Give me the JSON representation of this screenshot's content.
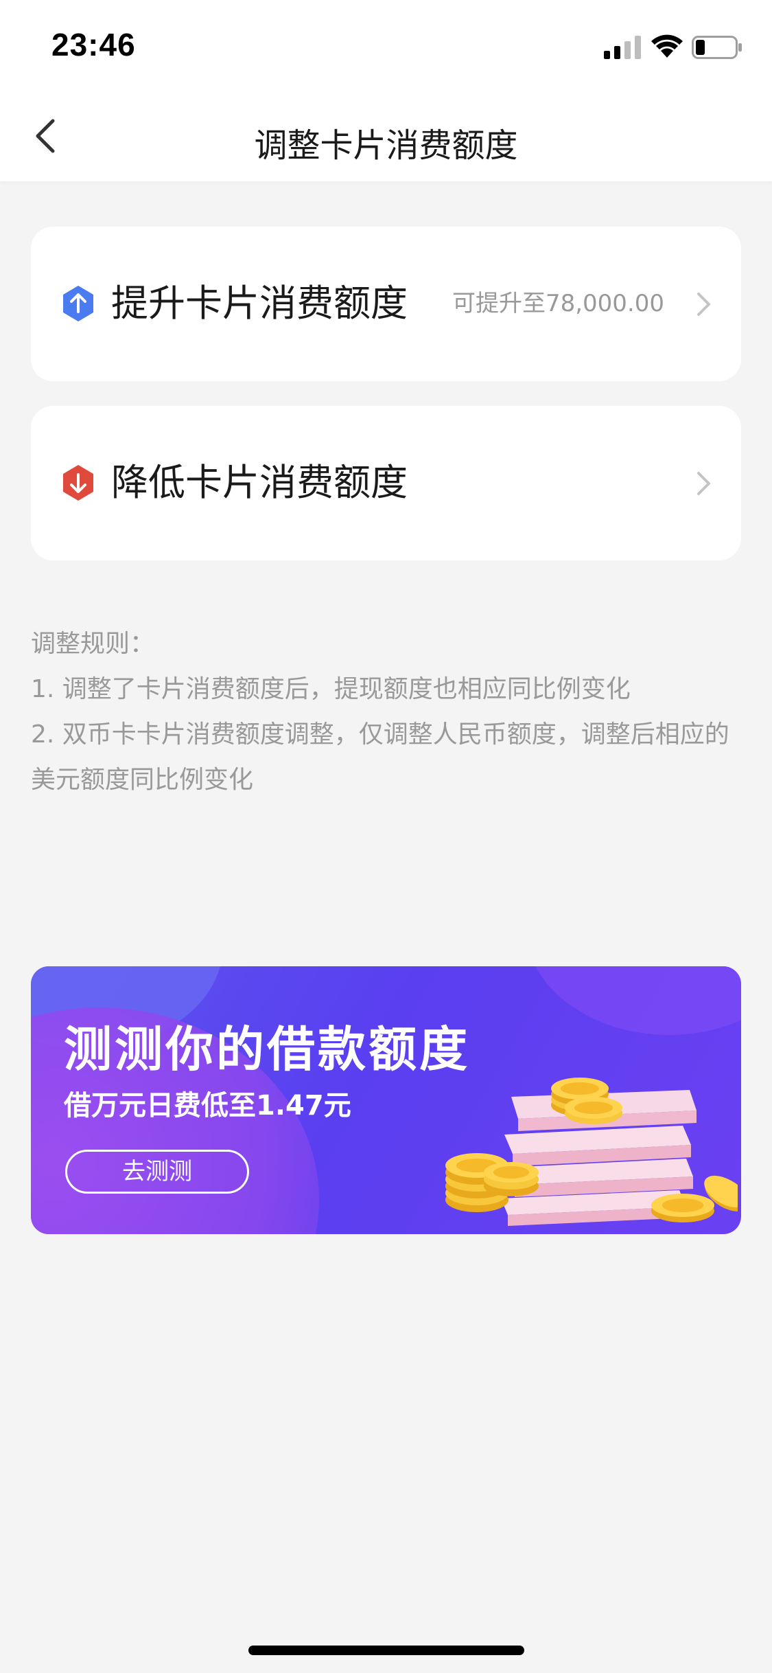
{
  "status_bar": {
    "time": "23:46"
  },
  "nav": {
    "title": "调整卡片消费额度"
  },
  "options": [
    {
      "label": "提升卡片消费额度",
      "hint": "可提升至78,000.00",
      "icon": "arrow-up-icon",
      "icon_color": "#4a7bf0"
    },
    {
      "label": "降低卡片消费额度",
      "hint": "",
      "icon": "arrow-down-icon",
      "icon_color": "#e04a3c"
    }
  ],
  "rules": {
    "heading": "调整规则：",
    "items": [
      "1. 调整了卡片消费额度后，提现额度也相应同比例变化",
      "2. 双币卡卡片消费额度调整，仅调整人民币额度，调整后相应的美元额度同比例变化"
    ]
  },
  "banner": {
    "title": "测测你的借款额度",
    "subtitle": "借万元日费低至1.47元",
    "button_label": "去测测"
  },
  "colors": {
    "background": "#f4f4f4",
    "banner_bg": "#5a3ff0",
    "secondary_text": "#999999"
  }
}
